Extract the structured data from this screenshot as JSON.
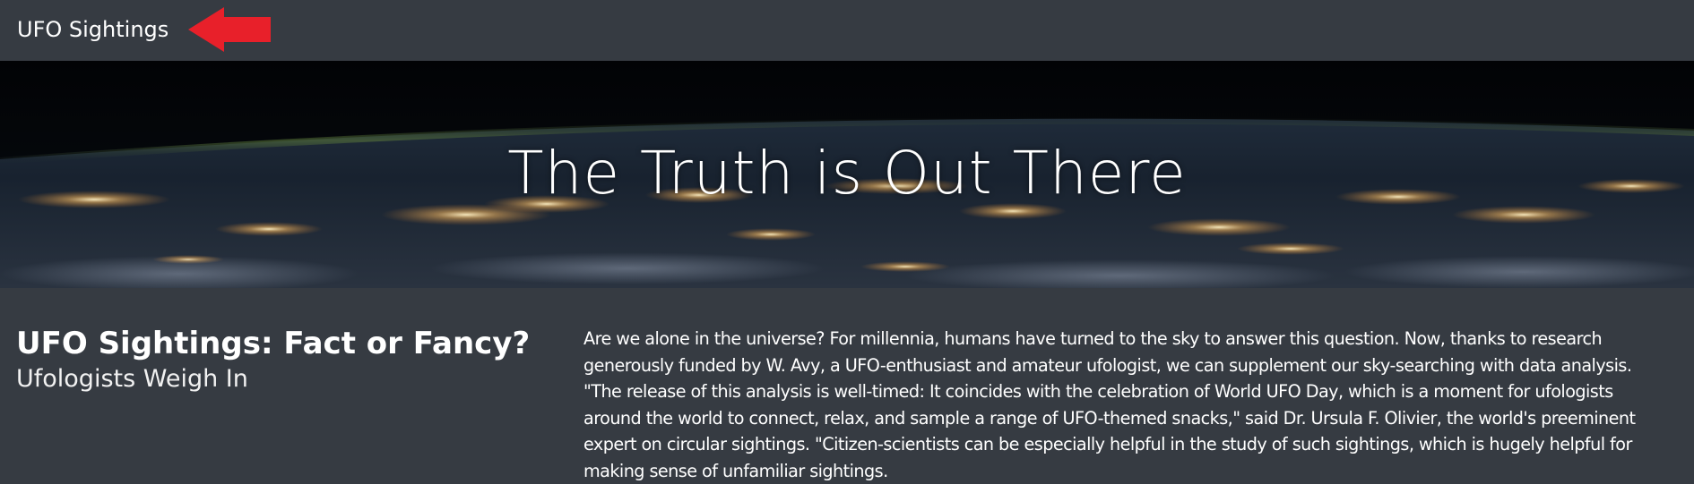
{
  "navbar": {
    "brand": "UFO Sightings"
  },
  "hero": {
    "title": "The Truth is Out There"
  },
  "intro": {
    "headline": "UFO Sightings: Fact or Fancy?",
    "subheadline": "Ufologists Weigh In",
    "article_text": "Are we alone in the universe? For millennia, humans have turned to the sky to answer this question. Now, thanks to research generously funded by W. Avy, a UFO-enthusiast and amateur ufologist, we can supplement our sky-searching with data analysis. \"The release of this analysis is well-timed: It coincides with the celebration of World UFO Day, which is a moment for ufologists around the world to connect, relax, and sample a range of UFO-themed snacks,\" said Dr. Ursula F. Olivier, the world's preeminent expert on circular sightings. \"Citizen-scientists can be especially helpful in the study of such sightings, which is hugely helpful for making sense of unfamiliar sightings."
  },
  "annotation": {
    "arrow_color": "#e8202a"
  },
  "colors": {
    "background": "#363b42",
    "text": "#ffffff"
  }
}
